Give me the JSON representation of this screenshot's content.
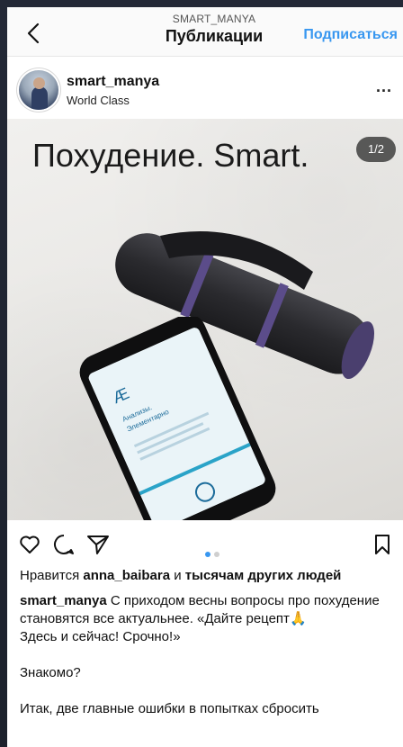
{
  "header": {
    "account": "SMART_MANYA",
    "title": "Публикации",
    "subscribe": "Подписаться"
  },
  "profile": {
    "username": "smart_manya",
    "location": "World Class",
    "more": "..."
  },
  "photo": {
    "overlay_text": "Похудение. Smart.",
    "counter": "1/2"
  },
  "likes": {
    "prefix": "Нравится ",
    "user": "anna_baibara",
    "middle": " и ",
    "rest": "тысячам других людей"
  },
  "caption": {
    "author": "smart_manya",
    "lines": [
      " С приходом весны вопросы про похудение становятся все актуальнее. «Дайте рецепт",
      "Здесь и сейчас! Срочно!»",
      "Знакомо?",
      "Итак, две главные ошибки в попытках сбросить"
    ],
    "emoji": "🙏"
  },
  "carousel": {
    "index": 1,
    "total": 2
  },
  "icons": [
    "back-icon",
    "heart-icon",
    "comment-icon",
    "share-icon",
    "bookmark-icon"
  ]
}
